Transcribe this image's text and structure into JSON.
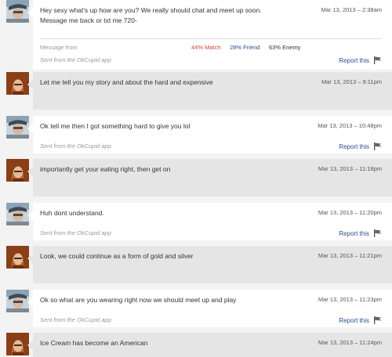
{
  "thread": {
    "messages": [
      {
        "sender": "other",
        "text": "Hey sexy what's up how are you? We really should chat and meet up soon. Message me back or txt me 720-",
        "date": "Mar 13, 2013 – 2:38am",
        "message_from_label": "Message from",
        "match": "44% Match",
        "friend": "28% Friend",
        "enemy": "63% Enemy",
        "sent_from": "Sent from the OkCupid app",
        "report": "Report this"
      },
      {
        "sender": "me",
        "text": "Let me tell you my story and about the hard and expensive",
        "date": "Mar 13, 2013 – 9:11pm"
      },
      {
        "sender": "other",
        "text": "Ok tell me then I got something hard to give you lol",
        "date": "Mar 13, 2013 – 10:48pm",
        "sent_from": "Sent from the OkCupid app",
        "report": "Report this"
      },
      {
        "sender": "me",
        "text": "importantly get your eating right, then get on",
        "date": "Mar 13, 2013 – 11:18pm"
      },
      {
        "sender": "other",
        "text": "Huh dont understand.",
        "date": "Mar 13, 2013 – 11:20pm",
        "sent_from": "Sent from the OkCupid app",
        "report": "Report this"
      },
      {
        "sender": "me",
        "text": "Look, we could continue as a form of gold and silver",
        "date": "Mar 13, 2013 – 11:21pm"
      },
      {
        "sender": "other",
        "text": "Ok so what are you wearing right now we should meet up and play",
        "date": "Mar 13, 2013 – 11:23pm",
        "sent_from": "Sent from the OkCupid app",
        "report": "Report this"
      },
      {
        "sender": "me",
        "text": "Ice Cream has become an American",
        "date": "Mar 13, 2013 – 11:24pm"
      }
    ]
  },
  "colors": {
    "page_background": "#f3f3f3",
    "other_bubble": "#ffffff",
    "my_bubble": "#e5e5e5",
    "link": "#2b4e8c",
    "match": "#d0463f",
    "muted": "#999999"
  },
  "icons": {
    "report": "flag-icon",
    "other_avatar": "avatar-photo-man",
    "my_avatar": "avatar-photo-woman"
  }
}
